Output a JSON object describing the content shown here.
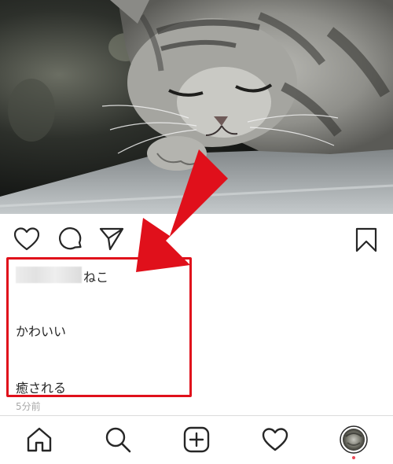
{
  "post": {
    "image_alt": "sleeping tabby cat",
    "caption_name_suffix": "ねこ",
    "caption_line_2": "かわいい",
    "caption_line_3": "癒される",
    "timestamp": "5分前"
  },
  "actions": {
    "like": "heart-icon",
    "comment": "comment-icon",
    "share": "paper-plane-icon",
    "save": "bookmark-icon"
  },
  "nav": {
    "items": [
      "home-icon",
      "search-icon",
      "new-post-icon",
      "activity-heart-icon",
      "profile-avatar"
    ]
  },
  "colors": {
    "highlight": "#e0101b",
    "notification": "#ed4956",
    "muted_text": "#a8a8a8"
  }
}
